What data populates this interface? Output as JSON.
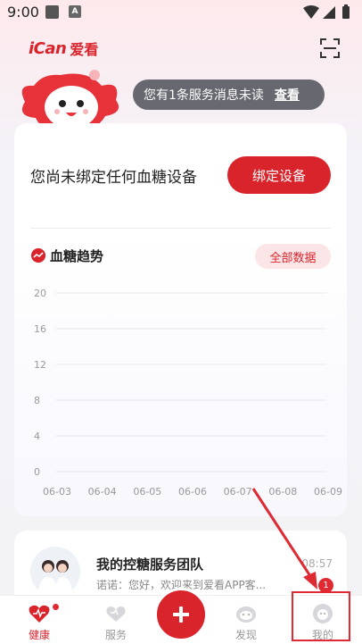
{
  "status_bar": {
    "time": "9:00",
    "notif_letter": "A"
  },
  "header": {
    "logo_mark": "iCan",
    "logo_text": "爱看"
  },
  "message": {
    "text": "您有1条服务消息未读",
    "view_label": "查看"
  },
  "device": {
    "no_device_text": "您尚未绑定任何血糖设备",
    "bind_label": "绑定设备"
  },
  "trend": {
    "title": "血糖趋势",
    "all_data_label": "全部数据"
  },
  "chart_data": {
    "type": "line",
    "title": "血糖趋势",
    "categories": [
      "06-03",
      "06-04",
      "06-05",
      "06-06",
      "06-07",
      "06-08",
      "06-09"
    ],
    "y_ticks": [
      "20",
      "16",
      "12",
      "8",
      "4",
      "0"
    ],
    "ylim": [
      0,
      20
    ],
    "series": [],
    "grid": true
  },
  "team": {
    "name": "我的控糖服务团队",
    "time": "08:57",
    "message": "诺诺：您好，欢迎来到爱看APP客..."
  },
  "tabs": [
    {
      "label": "健康",
      "icon": "health-icon",
      "active": true
    },
    {
      "label": "服务",
      "icon": "service-icon",
      "active": false
    },
    {
      "label": "发现",
      "icon": "discover-icon",
      "active": false
    },
    {
      "label": "我的",
      "icon": "profile-icon",
      "active": false
    }
  ],
  "badge_count": "1",
  "colors": {
    "accent": "#d9242c",
    "badge": "#e02a33"
  }
}
